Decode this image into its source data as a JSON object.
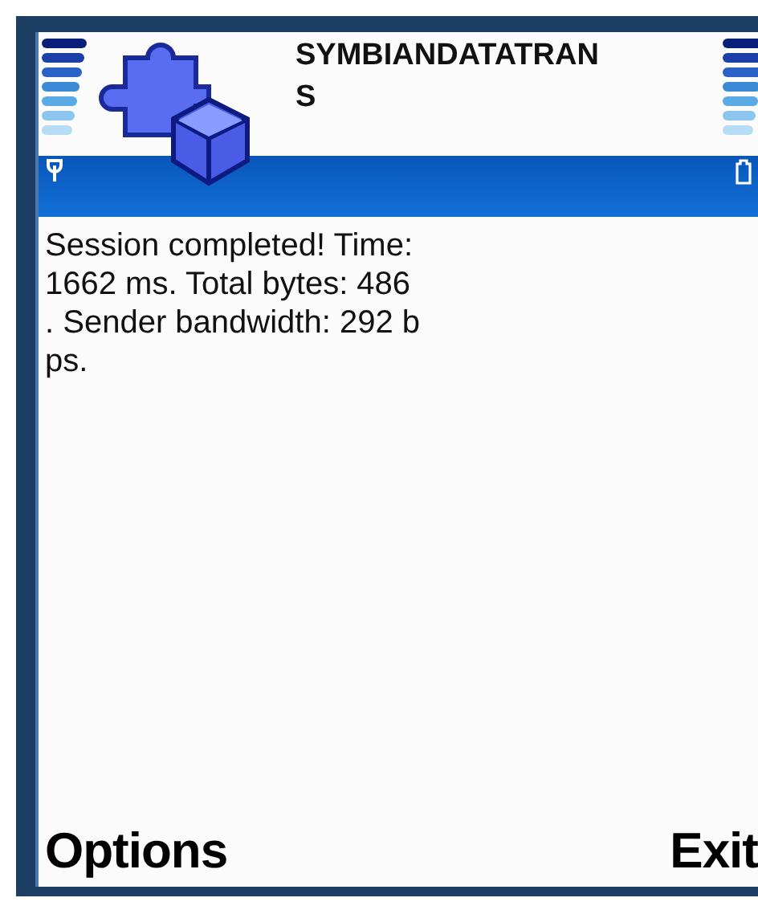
{
  "title_lines": [
    "SYMBIANDATATRAN",
    "S"
  ],
  "message_lines": [
    "Session completed! Time:",
    "1662 ms. Total bytes: 486",
    ". Sender bandwidth: 292 b",
    "ps."
  ],
  "softkeys": {
    "left": "Options",
    "right": "Exit"
  }
}
